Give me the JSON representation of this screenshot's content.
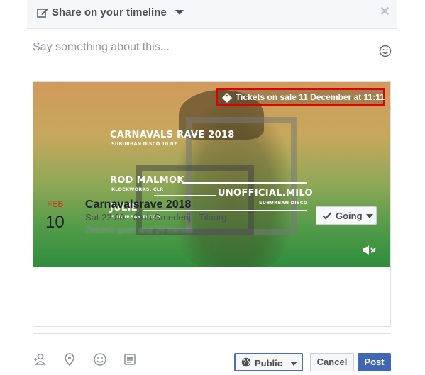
{
  "header": {
    "title": "Share on your timeline",
    "close_glyph": "✕"
  },
  "composer": {
    "placeholder": "Say something about this..."
  },
  "poster": {
    "tickets": "Tickets on sale 11 December at 11:11",
    "event_name": "CARNAVALS RAVE 2018",
    "event_sub": "SUBURBAN DISCO 10.02",
    "artists": [
      {
        "name": "ROD MALMOK",
        "sub": "KLOCKWORKS, CLR"
      },
      {
        "name": "UNOFFICIAL.MILO",
        "sub": "SUBURBAN DISCO"
      },
      {
        "name": "JULIE",
        "sub": "SUBURBAN DISCO"
      }
    ]
  },
  "event": {
    "month": "FEB",
    "day": "10",
    "title": "Carnavalsrave 2018",
    "subtitle": "Sat 22:00 · Club Smederij · Tilburg",
    "friends": "Zeezeiz gaan and 24 friends",
    "going_label": "Going"
  },
  "footer": {
    "public_label": "Public",
    "cancel_label": "Cancel",
    "post_label": "Post"
  },
  "icons": [
    "edit-icon",
    "close-icon",
    "emoji-icon",
    "ticket-icon",
    "mute-icon",
    "check-icon",
    "tag-friends-icon",
    "location-icon",
    "feeling-icon",
    "sticker-icon",
    "globe-icon"
  ],
  "colors": {
    "accent": "#4267b2",
    "month": "#e02222",
    "highlight": "#e00000"
  }
}
